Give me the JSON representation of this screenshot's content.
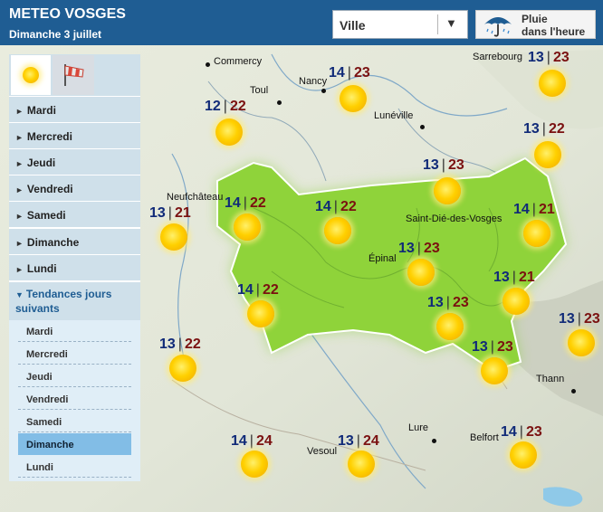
{
  "header": {
    "title": "METEO VOSGES",
    "date": "Dimanche 3 juillet",
    "city_select": "Ville",
    "rain_button": [
      "Pluie",
      "dans l'heure"
    ]
  },
  "sidebar": {
    "days": [
      "Mardi",
      "Mercredi",
      "Jeudi",
      "Vendredi",
      "Samedi",
      "Dimanche",
      "Lundi"
    ],
    "trends_label": "Tendances jours suivants",
    "trend_days": [
      "Mardi",
      "Mercredi",
      "Jeudi",
      "Vendredi",
      "Samedi",
      "Dimanche",
      "Lundi"
    ],
    "selected": "Dimanche"
  },
  "map": {
    "cities": [
      "Commercy",
      "Toul",
      "Nancy",
      "Lunéville",
      "Sarrebourg",
      "Neufchâteau",
      "Saint-Dié-des-Vosges",
      "Épinal",
      "Thann",
      "Lure",
      "Vesoul",
      "Belfort"
    ],
    "forecasts": [
      {
        "min": "14",
        "max": "23",
        "icon": "sun-icon"
      },
      {
        "min": "13",
        "max": "23",
        "icon": "sun-icon"
      },
      {
        "min": "12",
        "max": "22",
        "icon": "sun-icon"
      },
      {
        "min": "13",
        "max": "22",
        "icon": "sun-icon"
      },
      {
        "min": "13",
        "max": "23",
        "icon": "sun-icon"
      },
      {
        "min": "14",
        "max": "22",
        "icon": "sun-icon"
      },
      {
        "min": "14",
        "max": "22",
        "icon": "sun-icon"
      },
      {
        "min": "13",
        "max": "21",
        "icon": "sun-icon"
      },
      {
        "min": "14",
        "max": "21",
        "icon": "sun-icon"
      },
      {
        "min": "13",
        "max": "23",
        "icon": "sun-icon"
      },
      {
        "min": "14",
        "max": "22",
        "icon": "sun-icon"
      },
      {
        "min": "13",
        "max": "21",
        "icon": "sun-icon"
      },
      {
        "min": "13",
        "max": "23",
        "icon": "sun-icon"
      },
      {
        "min": "13",
        "max": "23",
        "icon": "sun-icon"
      },
      {
        "min": "13",
        "max": "22",
        "icon": "sun-icon"
      },
      {
        "min": "13",
        "max": "23",
        "icon": "sun-icon"
      },
      {
        "min": "14",
        "max": "23",
        "icon": "sun-icon"
      },
      {
        "min": "14",
        "max": "24",
        "icon": "sun-icon"
      },
      {
        "min": "13",
        "max": "24",
        "icon": "sun-icon"
      }
    ]
  },
  "colors": {
    "header": "#1f5d93",
    "map_background": "#eef0ea",
    "department": "#8fd33a",
    "min_temp": "#102a78",
    "max_temp": "#7a1010",
    "selected_day": "#82bde6"
  }
}
